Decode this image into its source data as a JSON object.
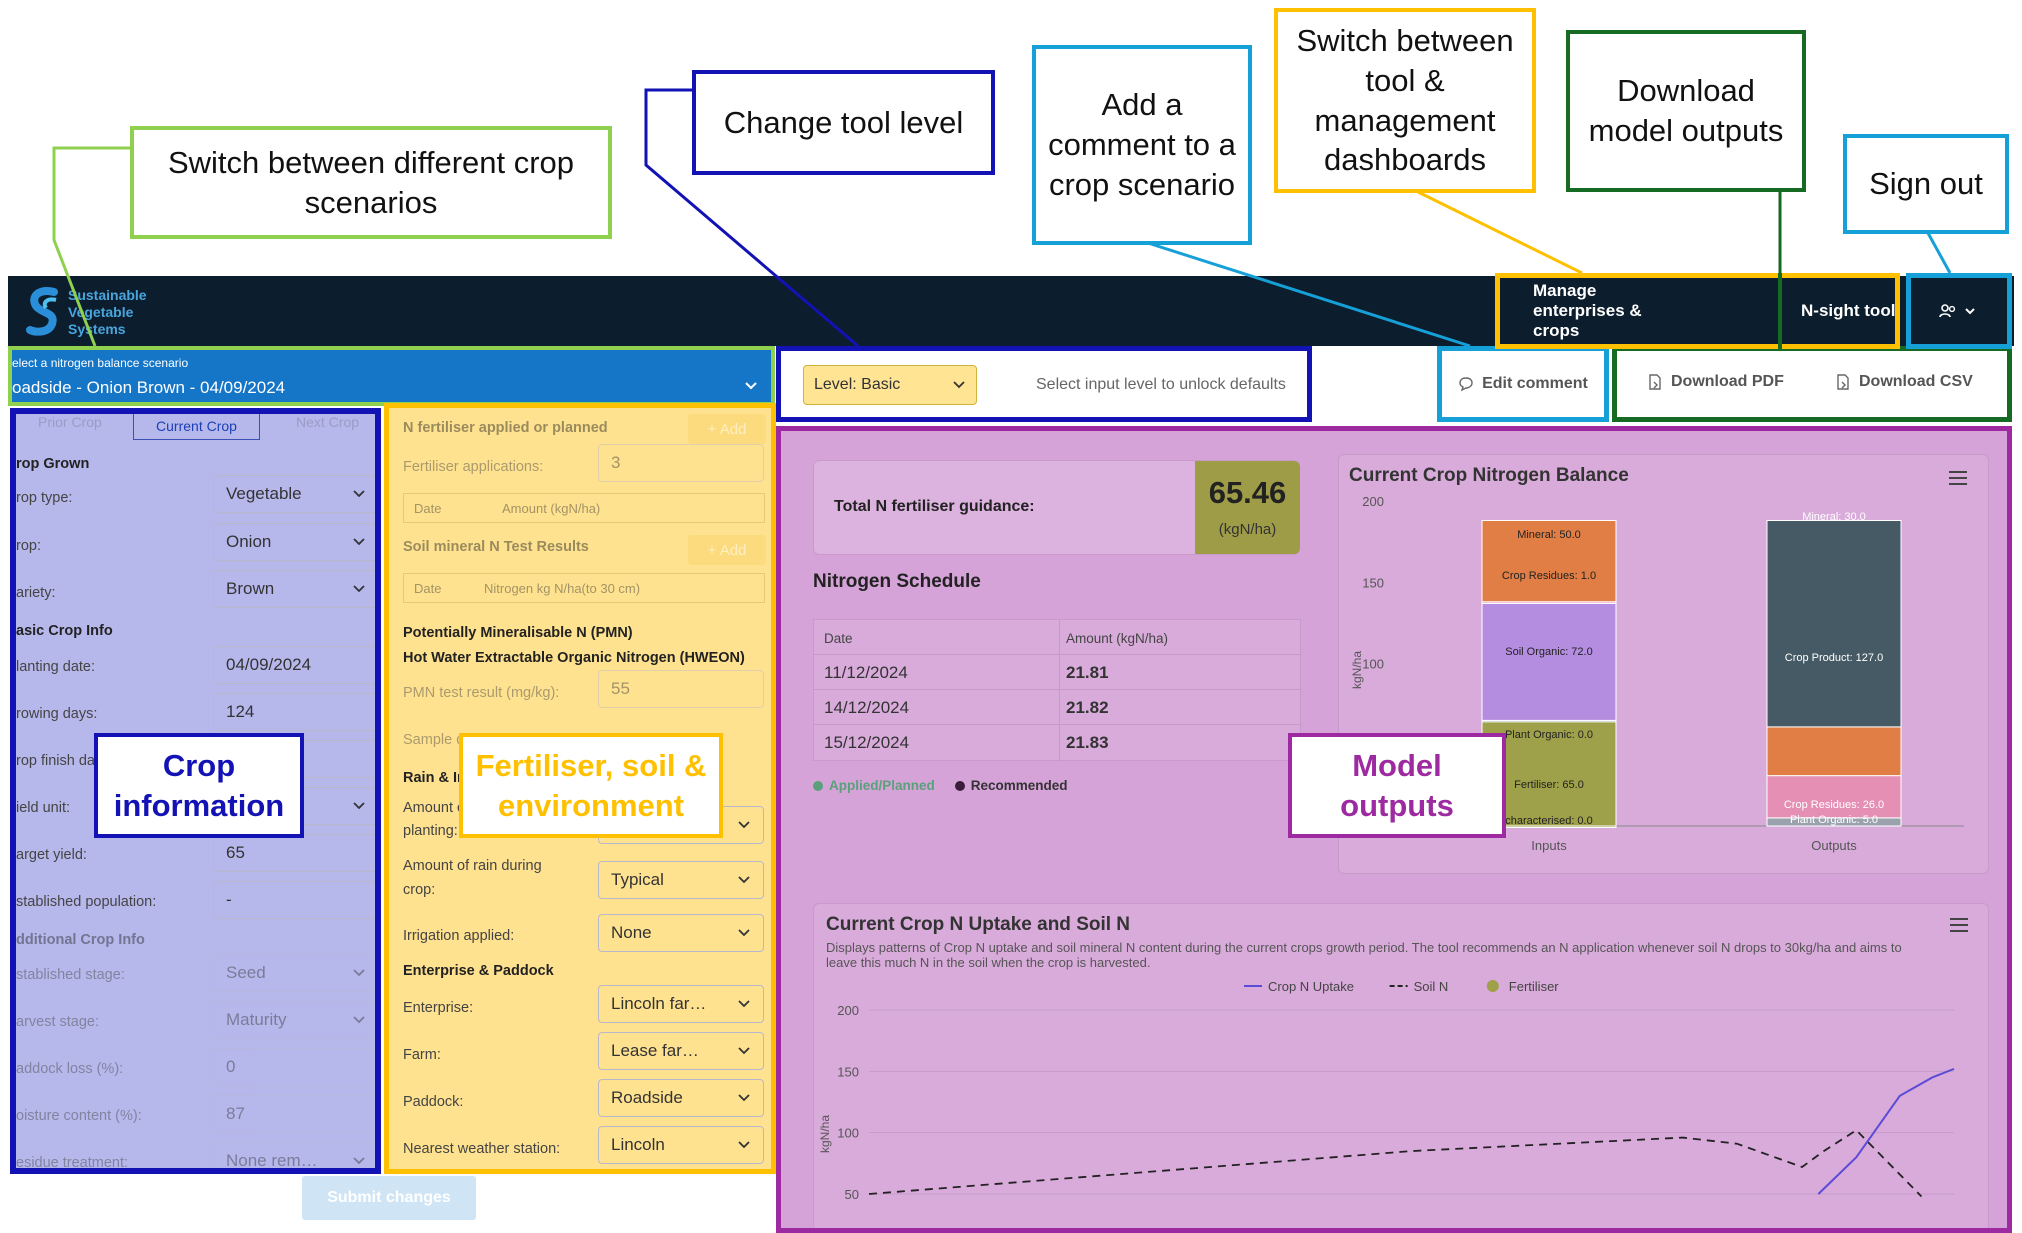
{
  "callouts": {
    "crop_scenarios": "Switch between different crop scenarios",
    "tool_level": "Change tool level",
    "add_comment": "Add a comment to a crop scenario",
    "switch_dash": "Switch between tool & management dashboards",
    "download": "Download model outputs",
    "sign_out": "Sign out",
    "crop_info": "Crop information",
    "fert_env": "Fertiliser, soil & environment",
    "model_outputs": "Model outputs"
  },
  "brand": {
    "line1": "Sustainable",
    "line2": "Vegetable",
    "line3": "Systems"
  },
  "nav": {
    "manage": "Manage enterprises & crops",
    "nsight": "N-sight tool"
  },
  "scenario": {
    "label": "elect a nitrogen balance scenario",
    "value": "oadside - Onion Brown - 04/09/2024"
  },
  "level": {
    "value": "Level: Basic",
    "hint": "Select input level to unlock defaults"
  },
  "actions": {
    "edit_comment": "Edit comment",
    "download_pdf": "Download PDF",
    "download_csv": "Download CSV"
  },
  "crop_tabs": [
    "Prior Crop",
    "Current Crop",
    "Next Crop"
  ],
  "crop_form": {
    "grown_header": "rop Grown",
    "crop_type_label": "rop type:",
    "crop_type": "Vegetable",
    "crop_label": "rop:",
    "crop": "Onion",
    "variety_label": "ariety:",
    "variety": "Brown",
    "basic_header": "asic Crop Info",
    "planting_label": "lanting date:",
    "planting": "04/09/2024",
    "growing_label": "rowing days:",
    "growing": "124",
    "finish_label": "rop finish da",
    "yield_unit_label": "ield unit:",
    "target_label": "arget yield:",
    "target": "65",
    "population_label": "stablished population:",
    "population": "-",
    "additional_header": "dditional Crop Info",
    "est_stage_label": "stablished stage:",
    "est_stage": "Seed",
    "harvest_label": "arvest stage:",
    "harvest": "Maturity",
    "paddock_loss_label": "addock loss (%):",
    "paddock_loss": "0",
    "moisture_label": "oisture content (%):",
    "moisture": "87",
    "residue_label": "esidue treatment:",
    "residue": "None rem…",
    "submit": "Submit changes"
  },
  "fert_form": {
    "n_fert_header": "N fertiliser applied or planned",
    "add1": "+ Add",
    "fert_apps_label": "Fertiliser applications:",
    "fert_apps": "3",
    "col_date": "Date",
    "col_amount": "Amount (kgN/ha)",
    "soil_header": "Soil mineral N Test Results",
    "add2": "+ Add",
    "col_date2": "Date",
    "col_nitrogen": "Nitrogen kg N/ha(to 30 cm)",
    "pmn_header": "Potentially Mineralisable N (PMN)",
    "hweon_header": "Hot Water Extractable Organic Nitrogen (HWEON)",
    "pmn_label": "PMN test result (mg/kg):",
    "pmn": "55",
    "sample_label": "Sample d",
    "rain_header": "Rain & Ir",
    "amount_label1": "Amount o",
    "amount_label2": "planting:",
    "rain_crop_label1": "Amount of rain during",
    "rain_crop_label2": "crop:",
    "rain_crop": "Typical",
    "irrigation_label": "Irrigation applied:",
    "irrigation": "None",
    "ent_header": "Enterprise & Paddock",
    "enterprise_label": "Enterprise:",
    "enterprise": "Lincoln far…",
    "farm_label": "Farm:",
    "farm": "Lease far…",
    "paddock_label": "Paddock:",
    "paddock": "Roadside",
    "weather_label": "Nearest weather station:",
    "weather": "Lincoln"
  },
  "guidance": {
    "label": "Total N fertiliser guidance:",
    "value": "65.46",
    "unit": "(kgN/ha)"
  },
  "schedule": {
    "title": "Nitrogen Schedule",
    "col_date": "Date",
    "col_amount": "Amount (kgN/ha)",
    "rows": [
      {
        "date": "11/12/2024",
        "amount": "21.81"
      },
      {
        "date": "14/12/2024",
        "amount": "21.82"
      },
      {
        "date": "15/12/2024",
        "amount": "21.83"
      }
    ],
    "legend_applied": "Applied/Planned",
    "legend_recommended": "Recommended"
  },
  "colors": {
    "applied": "#5aa07a",
    "recommended": "#3a1d3a",
    "mineral": "#e07e45",
    "crop_residues": "#e58fb4",
    "soil_organic": "#b48de0",
    "plant_organic": "#9aa3ad",
    "fertiliser": "#9ea04a",
    "crop_product": "#455a64",
    "uptake": "#5b4bd6"
  },
  "chart_data": [
    {
      "type": "bar",
      "title": "Current Crop Nitrogen Balance",
      "ylabel": "kgN/ha",
      "ylim": [
        0,
        200
      ],
      "yticks": [
        100,
        150,
        200
      ],
      "categories": [
        "Inputs",
        "Outputs"
      ],
      "series": [
        {
          "name": "characterised",
          "values": [
            0.0,
            null
          ]
        },
        {
          "name": "Fertiliser",
          "values": [
            65.0,
            null
          ]
        },
        {
          "name": "Plant Organic",
          "values": [
            0.0,
            5.0
          ]
        },
        {
          "name": "Soil Organic",
          "values": [
            72.0,
            null
          ]
        },
        {
          "name": "Crop Residues",
          "values": [
            1.0,
            26.0
          ]
        },
        {
          "name": "Mineral",
          "values": [
            50.0,
            30.0
          ]
        },
        {
          "name": "Crop Product",
          "values": [
            null,
            127.0
          ]
        }
      ],
      "bar_labels": [
        [
          "characterised: 0.0",
          "Fertiliser: 65.0",
          "Plant Organic: 0.0",
          "Soil Organic: 72.0",
          "Crop Residues: 1.0",
          "Mineral: 50.0"
        ],
        [
          "Plant Organic: 5.0",
          "Crop Residues: 26.0",
          "Crop Product: 127.0",
          "Mineral: 30.0"
        ]
      ]
    },
    {
      "type": "line",
      "title": "Current Crop N Uptake and Soil N",
      "subtitle": "Displays patterns of Crop N uptake and soil mineral N content during the current crops growth period. The tool recommends an N application whenever soil N drops to 30kg/ha and aims to leave this much N in the soil when the crop is harvested.",
      "ylabel": "kgN/ha",
      "yticks": [
        50,
        100,
        150,
        200
      ],
      "legend": [
        "Crop N Uptake",
        "Soil N",
        "Fertiliser"
      ],
      "series": [
        {
          "name": "Crop N Uptake",
          "points": [
            [
              0.875,
              50
            ],
            [
              0.91,
              80
            ],
            [
              0.95,
              130
            ],
            [
              0.98,
              145
            ],
            [
              1.0,
              152
            ]
          ]
        },
        {
          "name": "Soil N",
          "points": [
            [
              0,
              50
            ],
            [
              0.5,
              85
            ],
            [
              0.75,
              96
            ],
            [
              0.8,
              91
            ],
            [
              0.86,
              72
            ],
            [
              0.88,
              85
            ],
            [
              0.91,
              102
            ],
            [
              0.97,
              48
            ]
          ]
        }
      ]
    }
  ]
}
